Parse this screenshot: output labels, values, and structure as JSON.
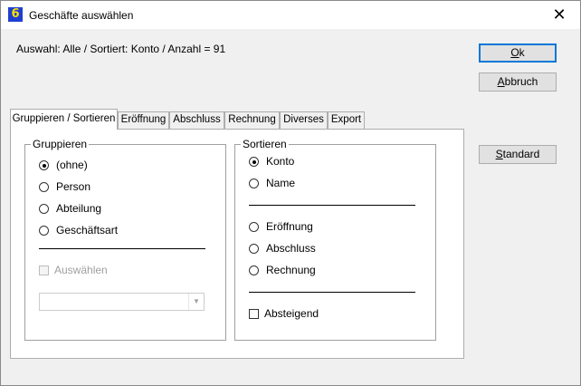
{
  "window": {
    "title": "Geschäfte auswählen",
    "icon_glyph": "6",
    "close_glyph": "✕"
  },
  "info": "Auswahl: Alle / Sortiert: Konto / Anzahl = 91",
  "buttons": {
    "ok": {
      "label_rest": "k",
      "mnemonic": "O"
    },
    "abbruch": {
      "label_rest": "bbruch",
      "mnemonic": "A"
    },
    "standard": {
      "label_rest": "tandard",
      "mnemonic": "S"
    }
  },
  "tabs": [
    "Gruppieren / Sortieren",
    "Eröffnung",
    "Abschluss",
    "Rechnung",
    "Diverses",
    "Export"
  ],
  "active_tab": 0,
  "group_gruppieren": {
    "title": "Gruppieren",
    "options": [
      "(ohne)",
      "Person",
      "Abteilung",
      "Geschäftsart"
    ],
    "selected": 0,
    "auswaehlen_label": "Auswählen",
    "auswaehlen_checked": false,
    "auswaehlen_enabled": false,
    "combo_value": ""
  },
  "group_sortieren": {
    "title": "Sortieren",
    "options_a": [
      "Konto",
      "Name"
    ],
    "options_b": [
      "Eröffnung",
      "Abschluss",
      "Rechnung"
    ],
    "selected": "Konto",
    "absteigend_label": "Absteigend",
    "absteigend_checked": false
  }
}
